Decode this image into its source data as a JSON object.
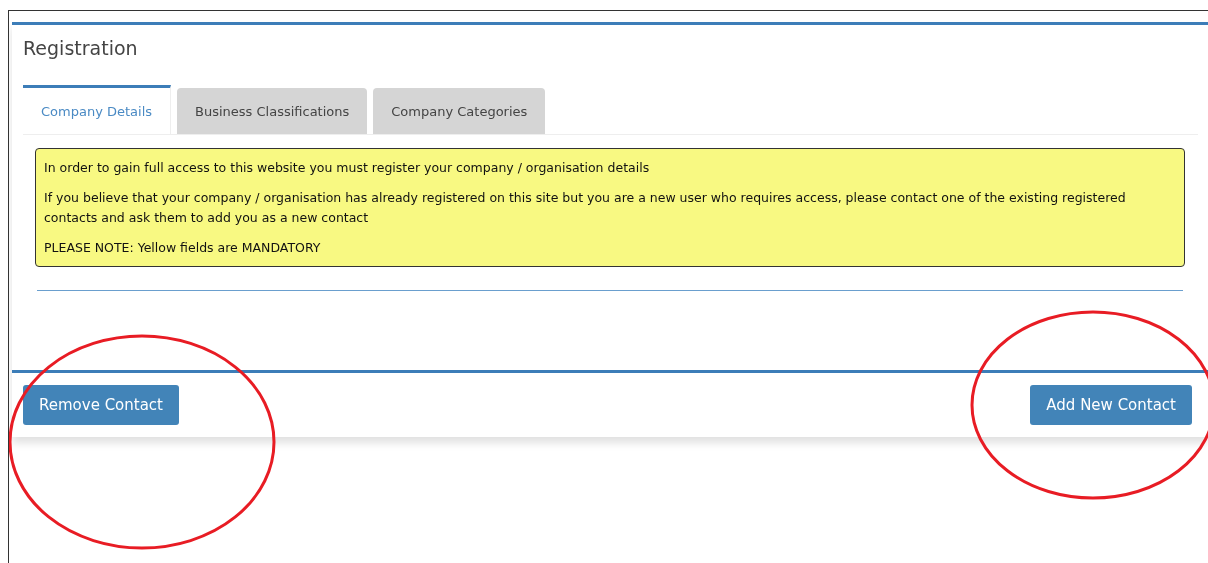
{
  "panel": {
    "title": "Registration"
  },
  "tabs": [
    {
      "label": "Company Details",
      "selected": true
    },
    {
      "label": "Business Classifications",
      "selected": false
    },
    {
      "label": "Company Categories",
      "selected": false
    }
  ],
  "notice": [
    "In order to gain full access to this website you must register your company / organisation details",
    "If you believe that your company / organisation has already registered on this site but you are a new user who requires access, please contact one of the existing registered contacts and ask them to add you as a new contact",
    "PLEASE NOTE: Yellow fields are MANDATORY"
  ],
  "footer_buttons": [
    "Remove Contact",
    "Add New Contact"
  ]
}
